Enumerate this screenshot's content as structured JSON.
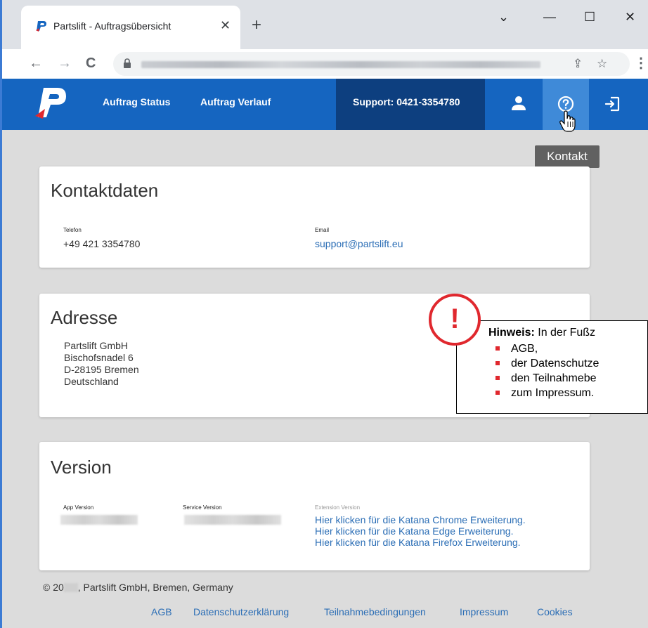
{
  "browser": {
    "tab_title": "Partslift - Auftragsübersicht",
    "close_tab": "✕",
    "new_tab": "+",
    "minimize": "—",
    "maximize": "☐",
    "close": "✕",
    "chevron": "⌄",
    "back": "←",
    "forward": "→",
    "reload": "C",
    "share": "⇪",
    "star": "☆",
    "menu": "⋮"
  },
  "navbar": {
    "links": [
      "Auftrag Status",
      "Auftrag Verlauf"
    ],
    "support": "Support: 0421-3354780",
    "tooltip": "Kontakt",
    "icons": [
      "user-icon",
      "help-circle-icon",
      "logout-icon"
    ],
    "active_icon": "help-circle-icon",
    "brand_color": "#1565c0"
  },
  "kontakt": {
    "title": "Kontaktdaten",
    "phone_label": "Telefon",
    "phone": "+49 421 3354780",
    "email_label": "Email",
    "email": "support@partslift.eu"
  },
  "adresse": {
    "title": "Adresse",
    "lines": [
      "Partslift GmbH",
      "Bischofsnadel 6",
      "D-28195 Bremen",
      "Deutschland"
    ]
  },
  "version": {
    "title": "Version",
    "app_label": "App Version",
    "service_label": "Service Version",
    "extension_label": "Extension Version",
    "links": [
      "Hier klicken für die Katana Chrome Erweiterung.",
      "Hier klicken für die Katana Edge Erweiterung.",
      "Hier klicken für die Katana Firefox Erweiterung."
    ]
  },
  "footer": {
    "copyright_prefix": "© 20",
    "copyright_suffix": ", Partslift GmbH, Bremen, Germany",
    "links": [
      "AGB",
      "Datenschutzerklärung",
      "Teilnahmebedingungen",
      "Impressum",
      "Cookies"
    ]
  },
  "callout": {
    "mark": "!",
    "bold": "Hinweis:",
    "text": " In der Fußz",
    "items": [
      "AGB,",
      "der Datenschutze",
      "den Teilnahmebe",
      "zum Impressum."
    ],
    "accent": "#e0282e"
  }
}
